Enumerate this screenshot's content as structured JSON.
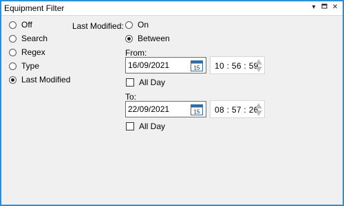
{
  "window": {
    "title": "Equipment Filter"
  },
  "titlebar_buttons": [
    {
      "icon": "dropdown-arrow-icon",
      "glyph": "▾"
    },
    {
      "icon": "restore-window-icon",
      "glyph": "▫"
    },
    {
      "icon": "close-icon",
      "glyph": "✕"
    }
  ],
  "filter_modes": [
    {
      "label": "Off",
      "selected": false
    },
    {
      "label": "Search",
      "selected": false
    },
    {
      "label": "Regex",
      "selected": false
    },
    {
      "label": "Type",
      "selected": false
    },
    {
      "label": "Last Modified",
      "selected": true
    }
  ],
  "last_modified": {
    "label": "Last Modified:",
    "options": [
      {
        "label": "On",
        "selected": false
      },
      {
        "label": "Between",
        "selected": true
      }
    ],
    "from": {
      "label": "From:",
      "date": "16/09/2021",
      "time": "10 : 56 : 59",
      "all_day_label": "All Day",
      "all_day_checked": false,
      "calendar_day": "15"
    },
    "to": {
      "label": "To:",
      "date": "22/09/2021",
      "time": "08 : 57 : 26",
      "all_day_label": "All Day",
      "all_day_checked": false,
      "calendar_day": "15"
    }
  },
  "colors": {
    "accent_border": "#2b8fd8",
    "panel": "#f0f0f0",
    "calendar_icon": "#2f6ea3"
  }
}
